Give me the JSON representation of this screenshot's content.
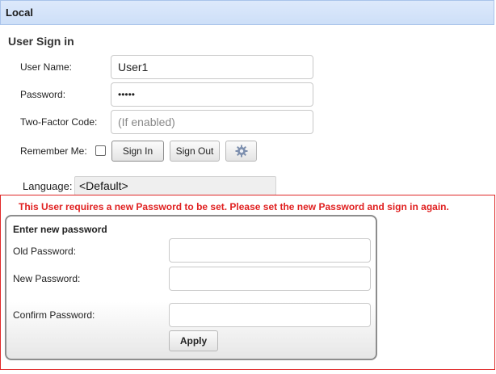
{
  "header": {
    "title": "Local"
  },
  "signin": {
    "section_title": "User Sign in",
    "username_label": "User Name:",
    "username_value": "User1",
    "password_label": "Password:",
    "password_value": "•••••",
    "twofactor_label": "Two-Factor Code:",
    "twofactor_placeholder": "(If enabled)",
    "remember_label": "Remember Me:",
    "remember_checked": false,
    "signin_button": "Sign In",
    "signout_button": "Sign Out",
    "settings_icon": "gear-icon",
    "language_label": "Language:",
    "language_value": "<Default>"
  },
  "password_change": {
    "warning": "This User requires a new Password to be set. Please set the new Password and sign in again.",
    "panel_title": "Enter new password",
    "old_label": "Old Password:",
    "new_label": "New Password:",
    "confirm_label": "Confirm Password:",
    "old_value": "",
    "new_value": "",
    "confirm_value": "",
    "apply_button": "Apply"
  },
  "colors": {
    "header_bg": "#cddff8",
    "warning_red": "#e02020",
    "panel_border": "#8d8d8d"
  }
}
